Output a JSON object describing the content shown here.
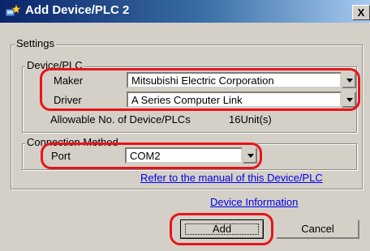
{
  "window": {
    "title": "Add Device/PLC 2",
    "close_glyph": "X",
    "icon": "add-device-icon"
  },
  "settings": {
    "group_label": "Settings",
    "device_plc": {
      "group_label": "Device/PLC",
      "maker_label": "Maker",
      "maker_value": "Mitsubishi Electric Corporation",
      "driver_label": "Driver",
      "driver_value": "A Series Computer Link",
      "allowable_label": "Allowable No. of Device/PLCs",
      "allowable_value": "16Unit(s)"
    },
    "connection": {
      "group_label": "Connection Method",
      "port_label": "Port",
      "port_value": "COM2"
    },
    "manual_link": "Refer to the manual of this Device/PLC"
  },
  "device_info_link": "Device Information",
  "buttons": {
    "add": "Add",
    "cancel": "Cancel"
  },
  "colors": {
    "highlight": "#e8141a",
    "link": "#0000ee",
    "dialog_face": "#d4d0c8",
    "titlebar_start": "#0a246a",
    "titlebar_end": "#a6caf0"
  }
}
